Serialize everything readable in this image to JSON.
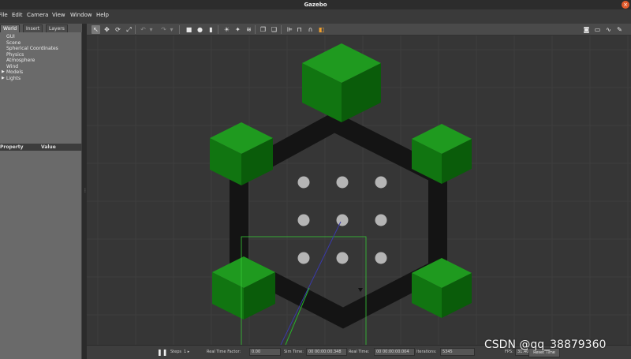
{
  "window": {
    "title": "Gazebo",
    "close_glyph": "×"
  },
  "menu": [
    "File",
    "Edit",
    "Camera",
    "View",
    "Window",
    "Help"
  ],
  "left_panel": {
    "tabs": [
      "World",
      "Insert",
      "Layers"
    ],
    "tree": [
      "GUI",
      "Scene",
      "Spherical Coordinates",
      "Physics",
      "Atmosphere",
      "Wind",
      "Models",
      "Lights"
    ],
    "property_header": {
      "property": "Property",
      "value": "Value"
    }
  },
  "toolbar": {
    "tools": [
      {
        "name": "select-arrow-icon",
        "glyph": "↖"
      },
      {
        "name": "translate-icon",
        "glyph": "✥"
      },
      {
        "name": "rotate-icon",
        "glyph": "⟳"
      },
      {
        "name": "scale-icon",
        "glyph": "⤢"
      },
      {
        "name": "undo-icon",
        "glyph": "↶"
      },
      {
        "name": "undo-history-icon",
        "glyph": "▾"
      },
      {
        "name": "redo-icon",
        "glyph": "↷"
      },
      {
        "name": "redo-history-icon",
        "glyph": "▾"
      },
      {
        "name": "box-shape-icon",
        "glyph": "■"
      },
      {
        "name": "sphere-shape-icon",
        "glyph": "●"
      },
      {
        "name": "cylinder-shape-icon",
        "glyph": "▮"
      },
      {
        "name": "point-light-icon",
        "glyph": "☀"
      },
      {
        "name": "spot-light-icon",
        "glyph": "✦"
      },
      {
        "name": "directional-light-icon",
        "glyph": "≋"
      },
      {
        "name": "copy-icon",
        "glyph": "❐"
      },
      {
        "name": "paste-icon",
        "glyph": "❏"
      },
      {
        "name": "align-icon",
        "glyph": "⊫"
      },
      {
        "name": "snap-icon",
        "glyph": "⊓"
      },
      {
        "name": "magnet-icon",
        "glyph": "∩"
      },
      {
        "name": "change-view-icon",
        "glyph": "◧"
      }
    ],
    "right_tools": [
      {
        "name": "screenshot-icon",
        "glyph": "◙"
      },
      {
        "name": "record-log-icon",
        "glyph": "▭"
      },
      {
        "name": "plot-icon",
        "glyph": "∿"
      },
      {
        "name": "video-record-icon",
        "glyph": "✎"
      }
    ]
  },
  "bottom": {
    "pause_glyph": "❚❚",
    "steps_label": "Steps",
    "step_arrows": "1 ▸",
    "real_time_factor_label": "Real Time Factor:",
    "real_time_factor": "0.00",
    "sim_time_label": "Sim Time:",
    "sim_time": "00 00:00:00.348",
    "real_time_label": "Real Time:",
    "real_time": "00 00:00:00.004",
    "iterations_label": "Iterations:",
    "iterations": "5345",
    "fps_label": "FPS:",
    "fps": "31.40",
    "reset_time": "Reset Time"
  },
  "watermark": "CSDN @qq_38879360",
  "colors": {
    "viewport_bg": "#363636",
    "grid": "#454545",
    "cube_top": "#1f9a1f",
    "cube_left": "#117511",
    "cube_right": "#0a5c0a",
    "wall": "#141414",
    "dot": "#b5b5b5",
    "selection_box": "#36c936",
    "axis_blue": "#3a3aa8",
    "axis_green": "#28b428"
  }
}
